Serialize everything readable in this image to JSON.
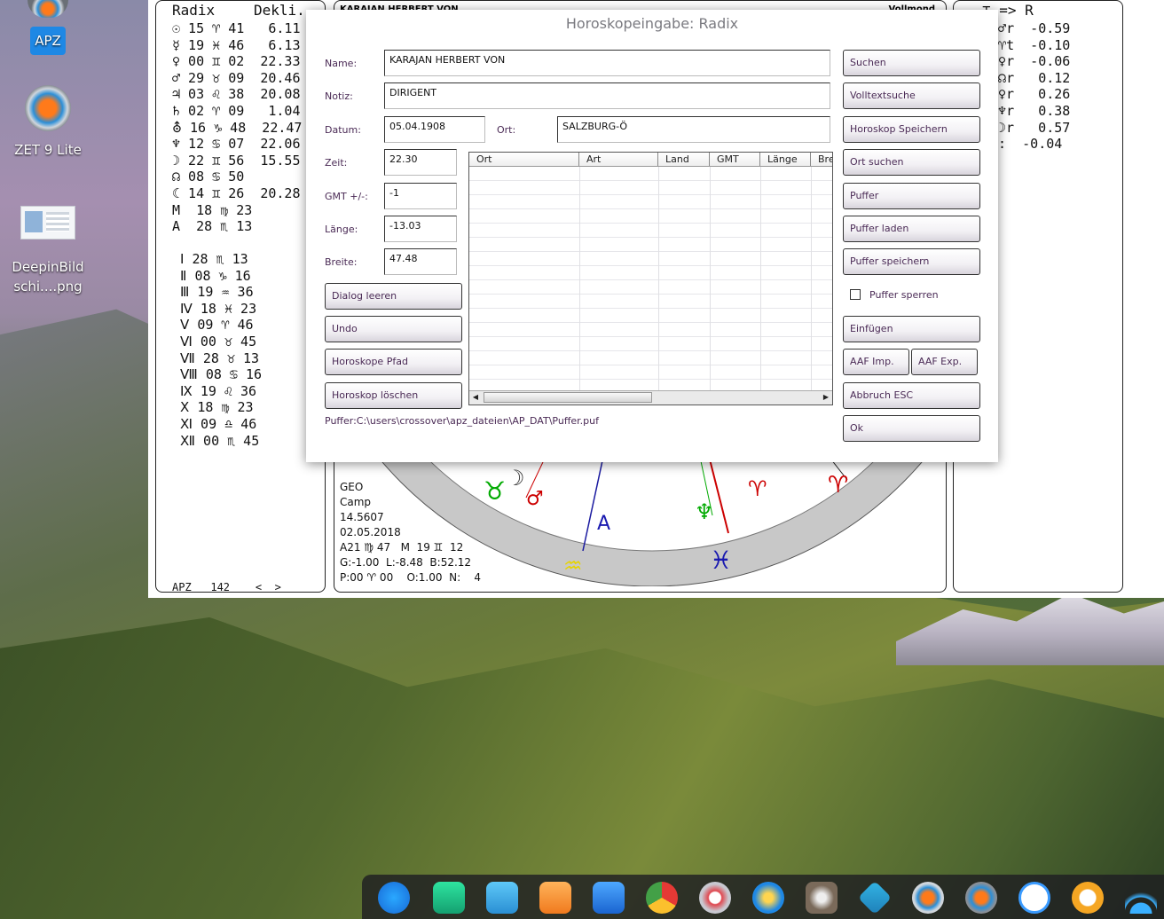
{
  "desktop": {
    "icons": [
      {
        "name": "APZ"
      },
      {
        "name": "ZET 9 Lite"
      },
      {
        "name": "DeepinBild\nschi....png"
      }
    ]
  },
  "left_panel": {
    "header_radix": "Radix",
    "header_dekli": "Dekli.",
    "planets": "☉ 15 ♈ 41   6.11 N\n☿ 19 ♓ 46   6.13 S\n♀ 00 ♊ 02  22.33 N\n♂ 29 ♉ 09  20.46 N\n♃ 03 ♌ 38  20.08 N\n♄ 02 ♈ 09   1.04 S\n⛢ 16 ♑ 48  22.47 S\n♆ 12 ♋ 07  22.06 N\n☽ 22 ♊ 56  15.55 N\n☊ 08 ♋ 50\n☾ 14 ♊ 26  20.28 N\nM  18 ♍ 23\nA  28 ♏ 13",
    "houses": " Ⅰ 28 ♏ 13\n Ⅱ 08 ♑ 16\n Ⅲ 19 ♒ 36\n Ⅳ 18 ♓ 23\n Ⅴ 09 ♈ 46\n Ⅵ 00 ♉ 45\n Ⅶ 28 ♉ 13\n Ⅷ 08 ♋ 16\n Ⅸ 19 ♌ 36\n Ⅹ 18 ♍ 23\n Ⅺ 09 ♎ 46\n Ⅻ 00 ♏ 45",
    "footer": "APZ   142    <  >"
  },
  "mid_panel": {
    "header_name": "KARAJAN HERBERT VON",
    "header_right": "Vollmond",
    "info": [
      "GEO",
      "Camp",
      "14.5607",
      "02.05.2018",
      "A21 ♍ 47   M  19 ♊  12",
      "G:-1.00  L:-8.48  B:52.12",
      "P:00 ♈ 00    O:1.00  N:    4"
    ]
  },
  "right_panel": {
    "header": "⊤ => R",
    "lines": "⊤☌♂r  -0.59\n⊤☌♈t  -0.10\n⊤☌♀r  -0.06\n⊤☍☊r   0.12\n⊤⚹♀r   0.26\n⊤□♆r   0.38\n⊤⚹☽r   0.57\n⊤-:  -0.04"
  },
  "dialog": {
    "title": "Horoskopeingabe: Radix",
    "labels": {
      "name": "Name:",
      "notiz": "Notiz:",
      "datum": "Datum:",
      "ort": "Ort:",
      "zeit": "Zeit:",
      "gmt": "GMT +/-:",
      "laenge": "Länge:",
      "breite": "Breite:"
    },
    "values": {
      "name": "KARAJAN HERBERT VON",
      "notiz": "DIRIGENT",
      "datum": "05.04.1908",
      "ort": "SALZBURG-Ö",
      "zeit": "22.30",
      "gmt": "-1",
      "laenge": "-13.03",
      "breite": "47.48"
    },
    "left_buttons": [
      "Dialog leeren",
      "Undo",
      "Horoskope Pfad",
      "Horoskop löschen"
    ],
    "grid_columns": [
      "Ort",
      "Art",
      "Land",
      "GMT",
      "Länge",
      "Bre"
    ],
    "puffer_path": "Puffer:C:\\users\\crossover\\apz_dateien\\AP_DAT\\Puffer.puf",
    "right_buttons": {
      "suchen": "Suchen",
      "volltext": "Volltextsuche",
      "speichern": "Horoskop Speichern",
      "ortsuchen": "Ort suchen",
      "puffer": "Puffer",
      "pufferladen": "Puffer laden",
      "pufferspeichern": "Puffer speichern",
      "puffersperren": "Puffer sperren",
      "einfuegen": "Einfügen",
      "aafimp": "AAF Imp.",
      "aafexp": "AAF Exp.",
      "abbruch": "Abbruch ESC",
      "ok": "Ok"
    }
  },
  "dock": {
    "icons": [
      "launcher-icon",
      "terminal-icon",
      "file-manager-icon",
      "app-store-icon",
      "video-icon",
      "chrome-icon",
      "settings-icon",
      "thunder-icon",
      "gimp-icon",
      "kodi-icon",
      "apz-icon",
      "zet-icon",
      "deepin-icon",
      "clock-icon",
      "wifi-icon"
    ]
  }
}
